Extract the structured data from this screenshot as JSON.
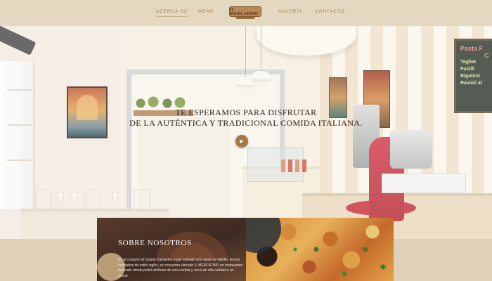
{
  "nav": {
    "items": [
      "Acerca de",
      "Menú",
      "Galería",
      "Contacto"
    ],
    "logo_text": "IL MERCATINO",
    "active_index": 0
  },
  "hero": {
    "tagline_line1": "Te esperamos para disfrutar",
    "tagline_line2": "de la auténtica y tradicional comida italiana.",
    "play_icon": "play-icon",
    "chalkboard": [
      "Pasta F",
      "C",
      "Tagliat",
      "Fusilli",
      "Rigatoni",
      "Ravioli al"
    ]
  },
  "about": {
    "title": "Sobre nosotros",
    "text": "En el corazón de Quinta Camacho, lugar rodeado por casas de ladrillo, techos inclinados de estilo inglés, se encuentra ubicado IL MERCATINO un restaurante mercado donde podrá disfrutar de una comida y vinos de alta calidad a un precio"
  },
  "colors": {
    "nav_bg": "#e4d8c1",
    "accent": "#a27a45",
    "about_card_bg": "#3e2a22"
  }
}
